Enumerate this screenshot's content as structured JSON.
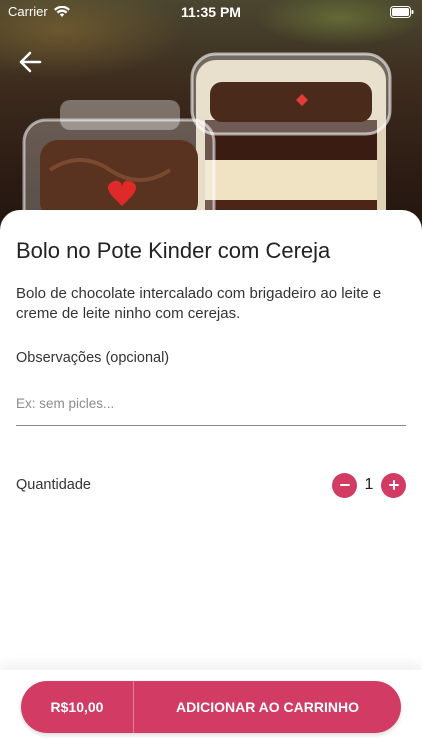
{
  "status_bar": {
    "carrier": "Carrier",
    "time": "11:35 PM",
    "wifi_icon": "wifi-icon",
    "battery_icon": "battery-icon"
  },
  "header": {
    "back_icon": "arrow-left-icon"
  },
  "product": {
    "title": "Bolo no Pote Kinder com Cereja",
    "description": "Bolo de chocolate intercalado com brigadeiro ao leite e creme de leite ninho com cerejas."
  },
  "observations": {
    "label": "Observações (opcional)",
    "value": "",
    "placeholder": "Ex: sem picles..."
  },
  "quantity": {
    "label": "Quantidade",
    "value": "1",
    "decrement_icon": "minus-icon",
    "increment_icon": "plus-icon"
  },
  "cart": {
    "price": "R$10,00",
    "add_label": "ADICIONAR AO CARRINHO"
  },
  "colors": {
    "accent": "#d13b64",
    "text_primary": "#222222",
    "text_secondary": "#333333",
    "placeholder": "#8c8c8c"
  }
}
